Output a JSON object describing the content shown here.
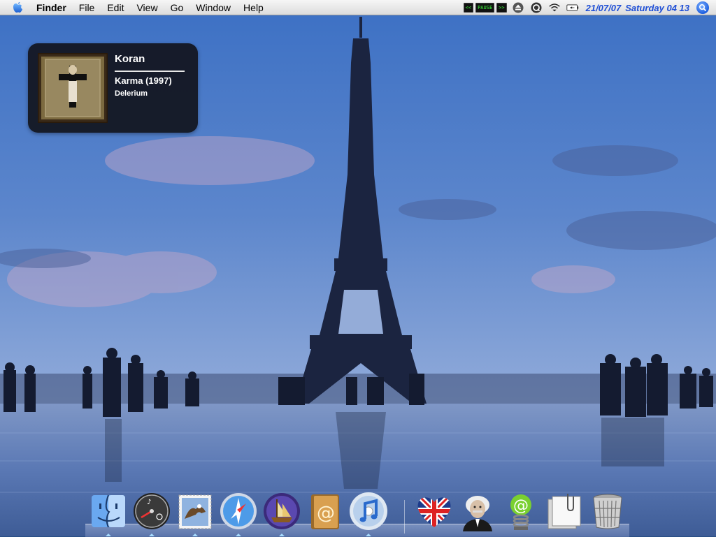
{
  "menubar": {
    "app_name": "Finder",
    "menus": [
      "File",
      "Edit",
      "View",
      "Go",
      "Window",
      "Help"
    ],
    "extras": {
      "itunes_prev": "<<",
      "itunes_pause": "PAUSE",
      "itunes_next": ">>",
      "date": "21/07/07",
      "day_time": "Saturday 04 13"
    }
  },
  "now_playing": {
    "track": "Koran",
    "album": "Karma (1997)",
    "artist": "Delerium"
  },
  "dock": {
    "items": [
      {
        "name": "finder",
        "icon": "finder-face-icon",
        "running": true
      },
      {
        "name": "dashboard",
        "icon": "dashboard-gauge-icon",
        "running": true
      },
      {
        "name": "mail",
        "icon": "mail-stamp-icon",
        "running": true
      },
      {
        "name": "safari",
        "icon": "safari-compass-icon",
        "running": true
      },
      {
        "name": "ship-app",
        "icon": "ship-globe-icon",
        "running": true
      },
      {
        "name": "address-book",
        "icon": "address-book-at-icon",
        "running": false
      },
      {
        "name": "itunes",
        "icon": "itunes-cd-icon",
        "running": true
      },
      {
        "name": "uk-heart",
        "icon": "union-jack-heart-icon",
        "running": false
      },
      {
        "name": "einstein",
        "icon": "einstein-portrait-icon",
        "running": false
      },
      {
        "name": "at-spring",
        "icon": "green-at-spring-icon",
        "running": false
      },
      {
        "name": "documents",
        "icon": "documents-clip-icon",
        "running": false
      },
      {
        "name": "trash",
        "icon": "trash-can-icon",
        "running": false
      }
    ]
  },
  "colors": {
    "menubar_clock": "#1f4fd6",
    "hud_background": "#12141e",
    "dock_indicator": "#a8dcff"
  }
}
